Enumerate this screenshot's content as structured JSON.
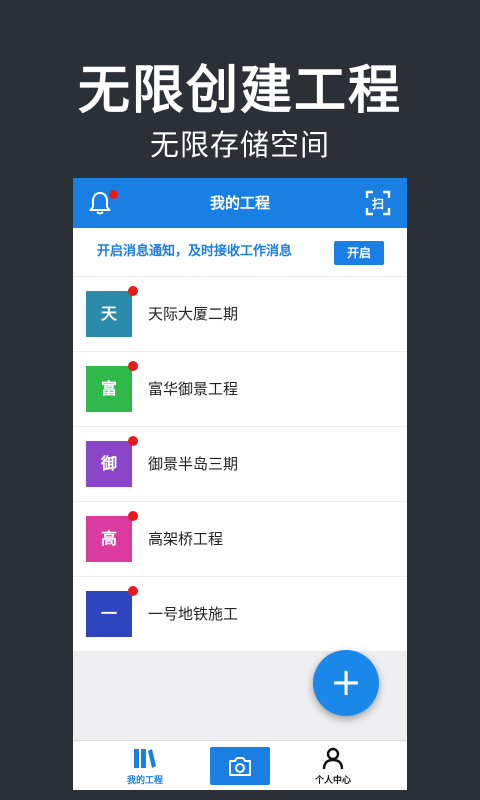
{
  "hero": {
    "title": "无限创建工程",
    "subtitle": "无限存储空间"
  },
  "app": {
    "title": "我的工程",
    "notify": {
      "text": "开启消息通知，及时接收工作消息",
      "button": "开启"
    },
    "projects": [
      {
        "avatar": "天",
        "name": "天际大厦二期",
        "color": "#2a8bab"
      },
      {
        "avatar": "富",
        "name": "富华御景工程",
        "color": "#31b84a"
      },
      {
        "avatar": "御",
        "name": "御景半岛三期",
        "color": "#8a45c8"
      },
      {
        "avatar": "高",
        "name": "高架桥工程",
        "color": "#db3a9e"
      },
      {
        "avatar": "一",
        "name": "一号地铁施工",
        "color": "#2f45c0"
      }
    ],
    "fab": "+",
    "tabs": {
      "left": "我的工程",
      "right": "个人中心"
    }
  },
  "colors": {
    "accent": "#1a7fe2",
    "badge": "#e81b1b",
    "background": "#2b2f36"
  },
  "icons": [
    "bell-icon",
    "scan-icon",
    "plus-icon",
    "books-icon",
    "camera-icon",
    "person-icon"
  ]
}
